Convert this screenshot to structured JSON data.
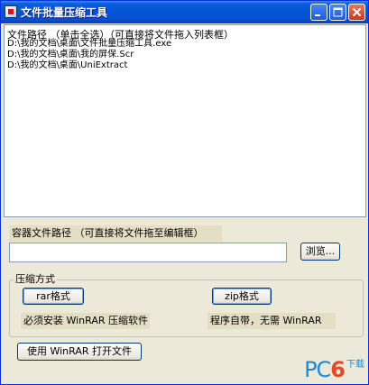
{
  "window": {
    "title": "文件批量压缩工具"
  },
  "titlebar_buttons": {
    "minimize_icon": "minimize-icon",
    "maximize_icon": "maximize-icon",
    "close_icon": "close-icon"
  },
  "file_list": {
    "header": "文件路径 （单击全选）（可直接将文件拖入列表框）",
    "items": [
      "D:\\我的文档\\桌面\\文件批量压缩工具.exe",
      "D:\\我的文档\\桌面\\我的屏保.Scr",
      "D:\\我的文档\\桌面\\UniExtract"
    ]
  },
  "container": {
    "label": "容器文件路径  （可直接将文件拖至编辑框）",
    "value": "",
    "browse_label": "浏览..."
  },
  "compress": {
    "group_label": "压缩方式",
    "rar_button": "rar格式",
    "zip_button": "zip格式",
    "rar_note": "必须安装 WinRAR 压缩软件",
    "zip_note": "程序自带，无需 WinRAR"
  },
  "open_with_winrar": "使用 WinRAR 打开文件",
  "watermark": {
    "pc": "PC",
    "six": "6",
    "download": "下载"
  },
  "colors": {
    "titlebar": "#0453d5",
    "window_bg": "#ece9d8",
    "label_bg": "#e4dfc4",
    "watermark_blue": "#1e88d0",
    "watermark_red": "#e24a2a"
  }
}
